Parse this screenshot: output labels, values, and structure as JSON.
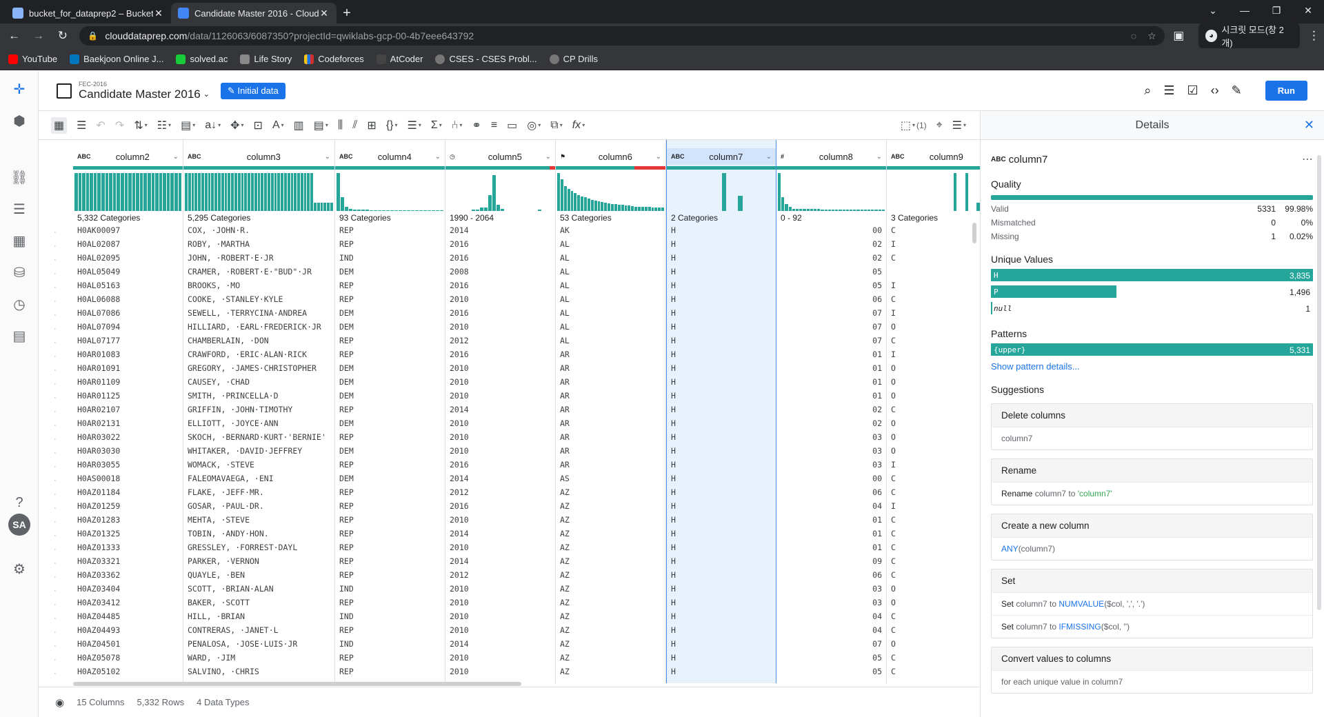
{
  "browser": {
    "tabs": [
      {
        "title": "bucket_for_dataprep2 – Bucket",
        "active": false
      },
      {
        "title": "Candidate Master 2016 - Cloud",
        "active": true
      }
    ],
    "url_host": "clouddataprep.com",
    "url_path": "/data/1126063/6087350?projectId=qwiklabs-gcp-00-4b7eee643792",
    "incognito_label": "시크릿 모드(창 2개)",
    "bookmarks": [
      "YouTube",
      "Baekjoon Online J...",
      "solved.ac",
      "Life Story",
      "Codeforces",
      "AtCoder",
      "CSES - CSES Probl...",
      "CP Drills"
    ]
  },
  "header": {
    "flow_name": "FEC-2016",
    "dataset_title": "Candidate Master 2016",
    "badge": "Initial data",
    "run_label": "Run"
  },
  "toolbar": {
    "selection_count": "(1)"
  },
  "grid": {
    "columns": [
      {
        "type": "ABC",
        "name": "column2",
        "summary": "5,332 Categories",
        "hist": [
          95,
          95,
          95,
          95,
          95,
          95,
          95,
          95,
          95,
          95,
          95,
          95,
          95,
          95,
          95,
          95,
          95,
          95,
          95,
          95,
          95,
          95,
          95,
          95,
          95,
          95,
          95,
          95
        ],
        "mismatch": 0
      },
      {
        "type": "ABC",
        "name": "column3",
        "summary": "5,295 Categories",
        "hist": [
          95,
          95,
          95,
          95,
          95,
          95,
          95,
          95,
          95,
          95,
          95,
          95,
          95,
          95,
          95,
          95,
          95,
          95,
          95,
          95,
          95,
          95,
          95,
          95,
          95,
          95,
          95,
          95,
          95,
          95,
          95,
          95,
          95,
          95,
          95,
          95,
          95,
          95,
          95,
          20,
          20,
          20,
          20,
          20,
          20
        ],
        "mismatch": 0
      },
      {
        "type": "ABC",
        "name": "column4",
        "summary": "93 Categories",
        "hist": [
          95,
          35,
          10,
          6,
          4,
          3,
          3,
          3,
          2,
          2,
          2,
          2,
          2,
          2,
          2,
          2,
          2,
          2,
          2,
          2,
          2,
          2,
          2,
          2,
          2,
          2
        ],
        "mismatch": 0
      },
      {
        "type": "DATE",
        "name": "column5",
        "summary": "1990 - 2064",
        "hist": [
          0,
          0,
          0,
          0,
          0,
          0,
          3,
          3,
          8,
          8,
          40,
          90,
          15,
          5,
          0,
          0,
          0,
          0,
          0,
          0,
          0,
          0,
          3,
          0,
          0,
          0
        ],
        "mismatch": 5
      },
      {
        "type": "FLAG",
        "name": "column6",
        "summary": "53 Categories",
        "hist": [
          95,
          80,
          62,
          55,
          50,
          45,
          40,
          37,
          34,
          31,
          28,
          26,
          24,
          22,
          20,
          19,
          18,
          17,
          16,
          15,
          14,
          13,
          12,
          11,
          10,
          10,
          10,
          10,
          9,
          9,
          9,
          9
        ],
        "mismatch": 28
      },
      {
        "type": "ABC",
        "name": "column7",
        "summary": "2 Categories",
        "hist": [
          0,
          0,
          0,
          0,
          0,
          0,
          0,
          0,
          0,
          0,
          95,
          0,
          0,
          38,
          0,
          0,
          0,
          0,
          0,
          0
        ],
        "mismatch": 0
      },
      {
        "type": "#",
        "name": "column8",
        "summary": "0 - 92",
        "hist": [
          95,
          35,
          18,
          10,
          6,
          5,
          5,
          5,
          5,
          5,
          5,
          5,
          4,
          4,
          4,
          4,
          4,
          4,
          4,
          4,
          4,
          4,
          4,
          4,
          4,
          4,
          4,
          4,
          4,
          4
        ],
        "mismatch": 0
      },
      {
        "type": "ABC",
        "name": "column9",
        "summary": "3 Categories",
        "hist": [
          0,
          0,
          0,
          0,
          0,
          0,
          0,
          0,
          0,
          0,
          0,
          0,
          0,
          0,
          0,
          0,
          0,
          95,
          0,
          0,
          95,
          0,
          0,
          20,
          0,
          0,
          0,
          0
        ],
        "mismatch": 0
      }
    ],
    "rows": [
      [
        "H0AK00097",
        "COX, ·JOHN·R.",
        "REP",
        "2014",
        "AK",
        "H",
        "00",
        "C"
      ],
      [
        "H0AL02087",
        "ROBY, ·MARTHA",
        "REP",
        "2016",
        "AL",
        "H",
        "02",
        "I"
      ],
      [
        "H0AL02095",
        "JOHN, ·ROBERT·E·JR",
        "IND",
        "2016",
        "AL",
        "H",
        "02",
        "C"
      ],
      [
        "H0AL05049",
        "CRAMER, ·ROBERT·E·\"BUD\"·JR",
        "DEM",
        "2008",
        "AL",
        "H",
        "05",
        ""
      ],
      [
        "H0AL05163",
        "BROOKS, ·MO",
        "REP",
        "2016",
        "AL",
        "H",
        "05",
        "I"
      ],
      [
        "H0AL06088",
        "COOKE, ·STANLEY·KYLE",
        "REP",
        "2010",
        "AL",
        "H",
        "06",
        "C"
      ],
      [
        "H0AL07086",
        "SEWELL, ·TERRYCINA·ANDREA",
        "DEM",
        "2016",
        "AL",
        "H",
        "07",
        "I"
      ],
      [
        "H0AL07094",
        "HILLIARD, ·EARL·FREDERICK·JR",
        "DEM",
        "2010",
        "AL",
        "H",
        "07",
        "O"
      ],
      [
        "H0AL07177",
        "CHAMBERLAIN, ·DON",
        "REP",
        "2012",
        "AL",
        "H",
        "07",
        "C"
      ],
      [
        "H0AR01083",
        "CRAWFORD, ·ERIC·ALAN·RICK",
        "REP",
        "2016",
        "AR",
        "H",
        "01",
        "I"
      ],
      [
        "H0AR01091",
        "GREGORY, ·JAMES·CHRISTOPHER",
        "DEM",
        "2010",
        "AR",
        "H",
        "01",
        "O"
      ],
      [
        "H0AR01109",
        "CAUSEY, ·CHAD",
        "DEM",
        "2010",
        "AR",
        "H",
        "01",
        "O"
      ],
      [
        "H0AR01125",
        "SMITH, ·PRINCELLA·D",
        "DEM",
        "2010",
        "AR",
        "H",
        "01",
        "O"
      ],
      [
        "H0AR02107",
        "GRIFFIN, ·JOHN·TIMOTHY",
        "REP",
        "2014",
        "AR",
        "H",
        "02",
        "C"
      ],
      [
        "H0AR02131",
        "ELLIOTT, ·JOYCE·ANN",
        "DEM",
        "2010",
        "AR",
        "H",
        "02",
        "O"
      ],
      [
        "H0AR03022",
        "SKOCH, ·BERNARD·KURT·'BERNIE'",
        "REP",
        "2010",
        "AR",
        "H",
        "03",
        "O"
      ],
      [
        "H0AR03030",
        "WHITAKER, ·DAVID·JEFFREY",
        "DEM",
        "2010",
        "AR",
        "H",
        "03",
        "O"
      ],
      [
        "H0AR03055",
        "WOMACK, ·STEVE",
        "REP",
        "2016",
        "AR",
        "H",
        "03",
        "I"
      ],
      [
        "H0AS00018",
        "FALEOMAVAEGA, ·ENI",
        "DEM",
        "2014",
        "AS",
        "H",
        "00",
        "C"
      ],
      [
        "H0AZ01184",
        "FLAKE, ·JEFF·MR.",
        "REP",
        "2012",
        "AZ",
        "H",
        "06",
        "C"
      ],
      [
        "H0AZ01259",
        "GOSAR, ·PAUL·DR.",
        "REP",
        "2016",
        "AZ",
        "H",
        "04",
        "I"
      ],
      [
        "H0AZ01283",
        "MEHTA, ·STEVE",
        "REP",
        "2010",
        "AZ",
        "H",
        "01",
        "C"
      ],
      [
        "H0AZ01325",
        "TOBIN, ·ANDY·HON.",
        "REP",
        "2014",
        "AZ",
        "H",
        "01",
        "C"
      ],
      [
        "H0AZ01333",
        "GRESSLEY, ·FORREST·DAYL",
        "REP",
        "2010",
        "AZ",
        "H",
        "01",
        "C"
      ],
      [
        "H0AZ03321",
        "PARKER, ·VERNON",
        "REP",
        "2014",
        "AZ",
        "H",
        "09",
        "C"
      ],
      [
        "H0AZ03362",
        "QUAYLE, ·BEN",
        "REP",
        "2012",
        "AZ",
        "H",
        "06",
        "C"
      ],
      [
        "H0AZ03404",
        "SCOTT, ·BRIAN·ALAN",
        "IND",
        "2010",
        "AZ",
        "H",
        "03",
        "O"
      ],
      [
        "H0AZ03412",
        "BAKER, ·SCOTT",
        "REP",
        "2010",
        "AZ",
        "H",
        "03",
        "O"
      ],
      [
        "H0AZ04485",
        "HILL, ·BRIAN",
        "IND",
        "2010",
        "AZ",
        "H",
        "04",
        "C"
      ],
      [
        "H0AZ04493",
        "CONTRERAS, ·JANET·L",
        "REP",
        "2010",
        "AZ",
        "H",
        "04",
        "C"
      ],
      [
        "H0AZ04501",
        "PENALOSA, ·JOSE·LUIS·JR",
        "IND",
        "2014",
        "AZ",
        "H",
        "07",
        "O"
      ],
      [
        "H0AZ05078",
        "WARD, ·JIM",
        "REP",
        "2010",
        "AZ",
        "H",
        "05",
        "C"
      ],
      [
        "H0AZ05102",
        "SALVINO, ·CHRIS",
        "REP",
        "2010",
        "AZ",
        "H",
        "05",
        "C"
      ]
    ]
  },
  "footer": {
    "columns": "15 Columns",
    "rows": "5,332 Rows",
    "types": "4 Data Types"
  },
  "details": {
    "title": "Details",
    "column_type": "ABC",
    "column_name": "column7",
    "quality_title": "Quality",
    "quality": [
      {
        "label": "Valid",
        "count": "5331",
        "pct": "99.98%"
      },
      {
        "label": "Mismatched",
        "count": "0",
        "pct": "0%"
      },
      {
        "label": "Missing",
        "count": "1",
        "pct": "0.02%"
      }
    ],
    "unique_title": "Unique Values",
    "unique_values": [
      {
        "value": "H",
        "count": "3,835",
        "fraction": 1.0
      },
      {
        "value": "P",
        "count": "1,496",
        "fraction": 0.39
      },
      {
        "value": "null",
        "count": "1",
        "fraction": 0.0
      }
    ],
    "patterns_title": "Patterns",
    "pattern": {
      "value": "{upper}",
      "count": "5,331"
    },
    "pattern_link": "Show pattern details...",
    "suggestions_title": "Suggestions",
    "suggestions": [
      {
        "title": "Delete columns",
        "lines": [
          [
            "",
            "column7",
            "",
            ""
          ]
        ]
      },
      {
        "title": "Rename",
        "lines": [
          [
            "Rename",
            " column7 to ",
            "",
            "'column7'"
          ]
        ]
      },
      {
        "title": "Create a new column",
        "lines": [
          [
            "",
            "",
            "ANY",
            "(column7)"
          ]
        ]
      },
      {
        "title": "Set",
        "lines": [
          [
            "Set",
            " column7 to ",
            "NUMVALUE",
            "($col, ',', '.')"
          ],
          [
            "Set",
            " column7 to ",
            "IFMISSING",
            "($col, '')"
          ]
        ]
      },
      {
        "title": "Convert values to columns",
        "lines": [
          [
            "",
            "for each unique value in column7",
            "",
            ""
          ]
        ]
      }
    ]
  }
}
